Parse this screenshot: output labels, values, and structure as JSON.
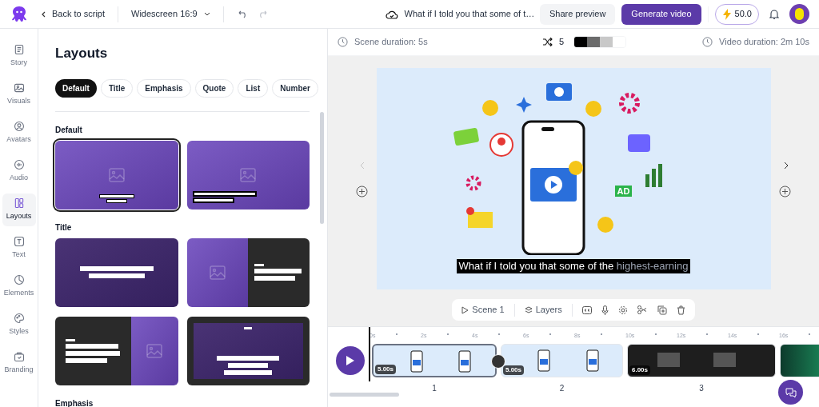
{
  "header": {
    "back": "Back to script",
    "aspect": "Widescreen 16:9",
    "project_title": "What if I told you that some of t…",
    "share": "Share preview",
    "generate": "Generate video",
    "credits": "50.0"
  },
  "rail": [
    {
      "label": "Story",
      "kind": "story",
      "selected": false
    },
    {
      "label": "Visuals",
      "kind": "visuals",
      "selected": false
    },
    {
      "label": "Avatars",
      "kind": "avatars",
      "selected": false
    },
    {
      "label": "Audio",
      "kind": "audio",
      "selected": false
    },
    {
      "label": "Layouts",
      "kind": "layouts",
      "selected": true
    },
    {
      "label": "Text",
      "kind": "text",
      "selected": false
    },
    {
      "label": "Elements",
      "kind": "elements",
      "selected": false
    },
    {
      "label": "Styles",
      "kind": "styles",
      "selected": false
    },
    {
      "label": "Branding",
      "kind": "branding",
      "selected": false
    }
  ],
  "panel": {
    "title": "Layouts",
    "filters": [
      {
        "label": "Default",
        "selected": true
      },
      {
        "label": "Title",
        "selected": false
      },
      {
        "label": "Emphasis",
        "selected": false
      },
      {
        "label": "Quote",
        "selected": false
      },
      {
        "label": "List",
        "selected": false
      },
      {
        "label": "Number",
        "selected": false
      }
    ],
    "sections": [
      {
        "title": "Default",
        "layouts": [
          {
            "kind": "image-center",
            "selected": true
          },
          {
            "kind": "image-left-text",
            "selected": false
          }
        ]
      },
      {
        "title": "Title",
        "layouts": [
          {
            "kind": "title-center",
            "selected": false
          },
          {
            "kind": "split-image-left",
            "selected": false
          },
          {
            "kind": "split-image-right",
            "selected": false
          },
          {
            "kind": "framed",
            "selected": false
          }
        ]
      },
      {
        "title": "Emphasis"
      }
    ]
  },
  "info_bar": {
    "scene_duration": "Scene duration: 5s",
    "shuffle_count": "5",
    "video_duration": "Video duration: 2m 10s"
  },
  "preview": {
    "caption_spoken": "What if I told you that some of the",
    "caption_upcoming": "highest-earning",
    "ad_label": "AD"
  },
  "toolbar": {
    "scene": "Scene 1",
    "layers": "Layers"
  },
  "timeline": {
    "ticks": [
      "0s",
      "2s",
      "4s",
      "6s",
      "8s",
      "10s",
      "12s",
      "14s",
      "16s"
    ],
    "clips": [
      {
        "kind": "illustration",
        "duration": "5.00s",
        "number": "1",
        "selected": true
      },
      {
        "kind": "illustration",
        "duration": "5.00s",
        "number": "2",
        "selected": false
      },
      {
        "kind": "video",
        "duration": "6.00s",
        "number": "3",
        "selected": false
      },
      {
        "kind": "video-green",
        "selected": false
      }
    ]
  }
}
